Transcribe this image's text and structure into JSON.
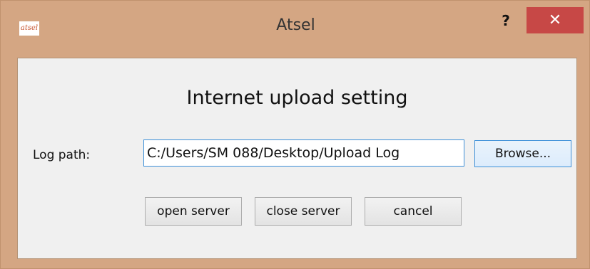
{
  "window": {
    "title": "Atsel",
    "icon_text": "atsel",
    "help_label": "?",
    "close_label": "✕"
  },
  "dialog": {
    "heading": "Internet upload setting",
    "log_path_label": "Log path:",
    "log_path_value": "C:/Users/SM 088/Desktop/Upload Log",
    "browse_label": "Browse...",
    "open_server_label": "open server",
    "close_server_label": "close server",
    "cancel_label": "cancel"
  },
  "colors": {
    "frame": "#d4a683",
    "close_button": "#c74846",
    "client_bg": "#f0f0f0",
    "focus_border": "#3c8fd8"
  }
}
